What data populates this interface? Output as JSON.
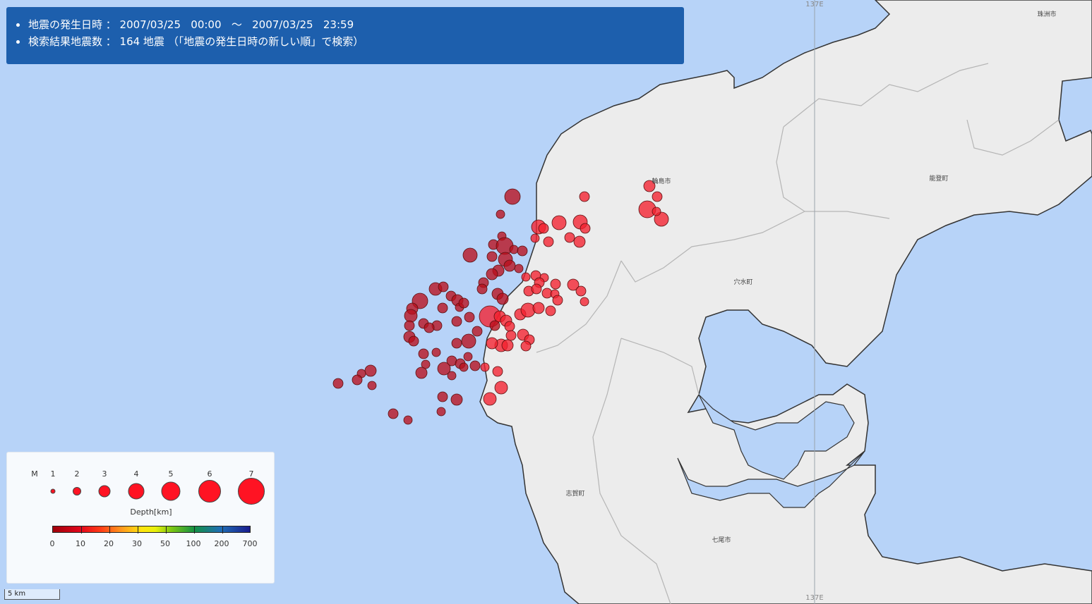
{
  "search_info": {
    "date_line": "地震の発生日時 ： 2007/03/25   00:00   ～   2007/03/25   23:59",
    "count_line": "検索結果地震数 ： 164 地震 （「地震の発生日時の新しい順」で検索）"
  },
  "map_labels": {
    "wajima": "輪島市",
    "suzu": "珠洲市",
    "noto": "能登町",
    "anamizu": "穴水町",
    "shika": "志賀町",
    "nanao": "七尾市",
    "meridian_top": "137E",
    "meridian_bottom": "137E"
  },
  "legend": {
    "magnitude_label": "M",
    "magnitudes": [
      "1",
      "2",
      "3",
      "4",
      "5",
      "6",
      "7"
    ],
    "depth_title": "Depth[km]",
    "depth_ticks": [
      "0",
      "10",
      "20",
      "30",
      "50",
      "100",
      "200",
      "700"
    ]
  },
  "scale_bar": {
    "label": "5 km"
  },
  "colors": {
    "sea": "#b7d3f8",
    "land": "#ececec",
    "banner": "#1d5fad",
    "quake": "#ff1323",
    "quake_deep_red": "#a0000a"
  },
  "earthquakes_shown": 164
}
